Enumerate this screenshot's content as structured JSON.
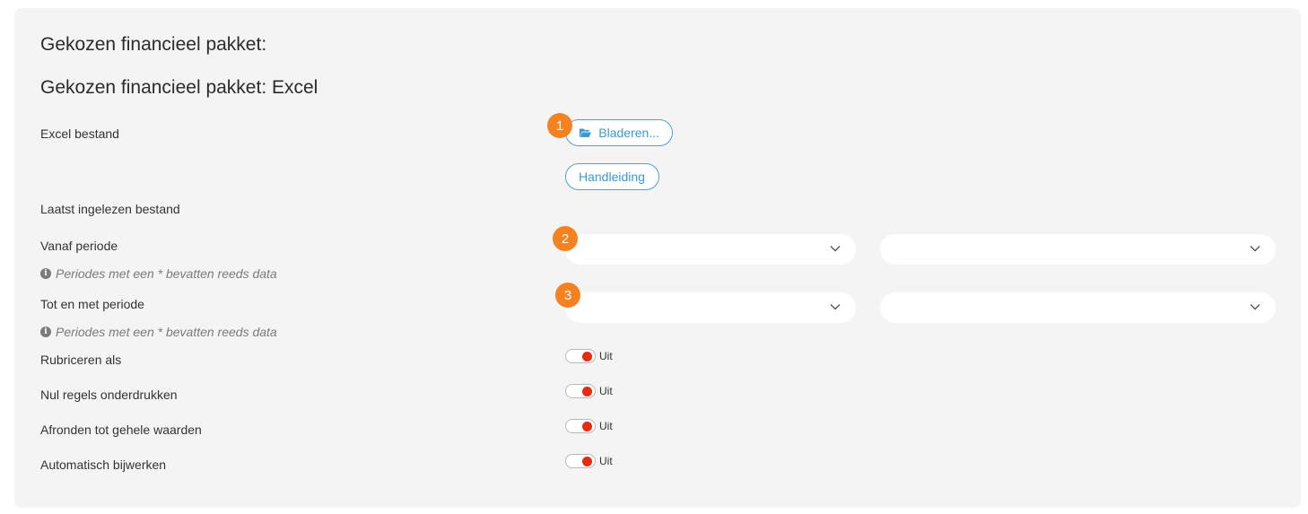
{
  "header": {
    "title_line1": "Gekozen financieel pakket:",
    "title_line2": "Gekozen financieel pakket: Excel"
  },
  "rows": {
    "excel_file_label": "Excel bestand",
    "last_read_label": "Laatst ingelezen bestand",
    "from_period_label": "Vanaf periode",
    "to_period_label": "Tot en met periode",
    "period_hint": "Periodes met een * bevatten reeds data"
  },
  "buttons": {
    "browse_label": "Bladeren...",
    "browse_icon": "folder-open-icon",
    "manual_label": "Handleiding"
  },
  "badges": [
    "1",
    "2",
    "3"
  ],
  "selects": {
    "from_period_value": "",
    "from_year_value": "",
    "to_period_value": "",
    "to_year_value": ""
  },
  "toggles": [
    {
      "label": "Rubriceren als",
      "state": "Uit"
    },
    {
      "label": "Nul regels onderdrukken",
      "state": "Uit"
    },
    {
      "label": "Afronden tot gehele waarden",
      "state": "Uit"
    },
    {
      "label": "Automatisch bijwerken",
      "state": "Uit"
    }
  ],
  "colors": {
    "accent": "#3a9ad6",
    "badge": "#f58220",
    "toggle_off": "#e52b12",
    "panel": "#f4f4f4"
  }
}
